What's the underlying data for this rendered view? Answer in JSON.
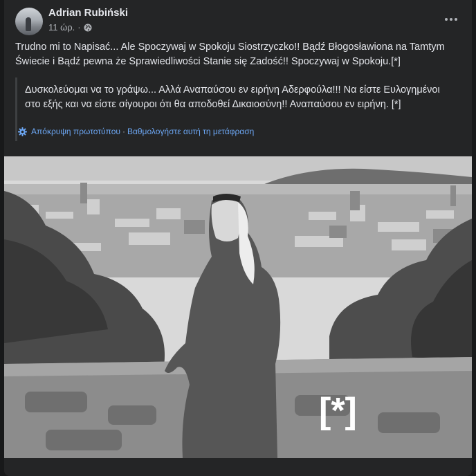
{
  "post": {
    "author": "Adrian Rubiński",
    "time": "11 ώρ.",
    "dot": "·",
    "text": "Trudno mi to Napisać... Ale Spoczywaj w Spokoju Siostrzyczko!! Bądź Błogosławiona na Tamtym Świecie i Bądź pewna  że Sprawiedliwości Stanie się Zadość!! Spoczywaj w Spokoju.[*]",
    "translation": "Δυσκολεύομαι να το γράψω... Αλλά Αναπαύσου εν ειρήνη Αδερφούλα!!! Να είστε Ευλογημένοι στο εξής και να είστε σίγουροι ότι θα αποδοθεί Δικαιοσύνη!! Αναπαύσου εν ειρήνη. [*]",
    "hide_original": "Απόκρυψη πρωτοτύπου",
    "link_separator": "·",
    "rate_translation": "Βαθμολογήστε αυτή τη μετάφραση",
    "photo_overlay": "[*]"
  },
  "icons": {
    "privacy": "globe-icon",
    "options": "more-options-icon",
    "translate": "gear-icon"
  },
  "colors": {
    "background": "#18191a",
    "card": "#242526",
    "text_primary": "#e4e6eb",
    "text_secondary": "#b0b3b8",
    "link": "#6ca6f2"
  }
}
